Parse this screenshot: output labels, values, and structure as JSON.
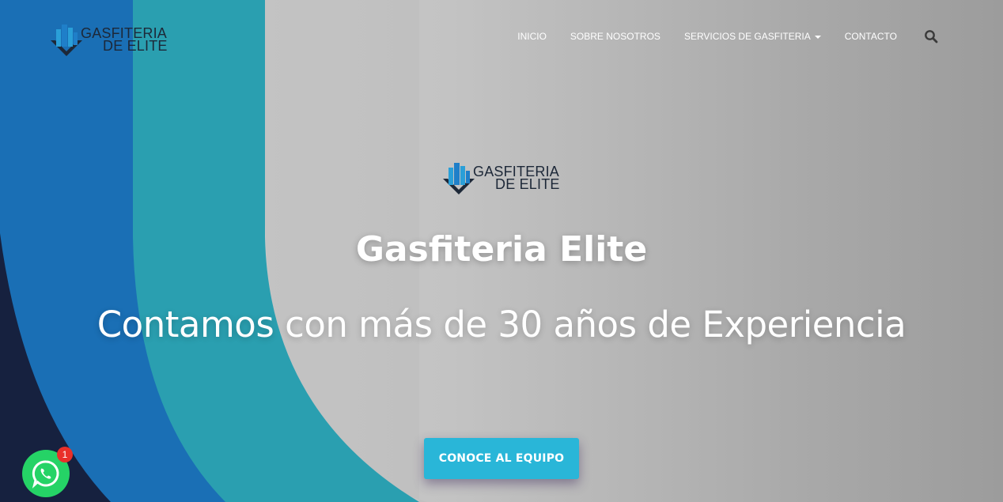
{
  "header": {
    "logo": {
      "line1": "GASFITERIA",
      "line2": "DE ELITE"
    },
    "nav": [
      {
        "label": "INICIO"
      },
      {
        "label": "SOBRE NOSOTROS"
      },
      {
        "label": "SERVICIOS DE GASFITERIA",
        "has_dropdown": true
      },
      {
        "label": "CONTACTO"
      }
    ],
    "search_icon": "search-icon"
  },
  "hero": {
    "logo": {
      "line1": "GASFITERIA",
      "line2": "DE ELITE"
    },
    "title": "Gasfiteria Elite",
    "subtitle": "Contamos con más de 30 años de Experiencia",
    "cta_label": "CONOCE AL EQUIPO"
  },
  "whatsapp": {
    "icon": "whatsapp-icon",
    "badge_count": "1"
  },
  "colors": {
    "accent": "#29b6d8",
    "navy": "#16213f",
    "blue": "#1a6fb5",
    "teal": "#2a9fb0",
    "whatsapp": "#25d366",
    "badge": "#e9302a"
  }
}
